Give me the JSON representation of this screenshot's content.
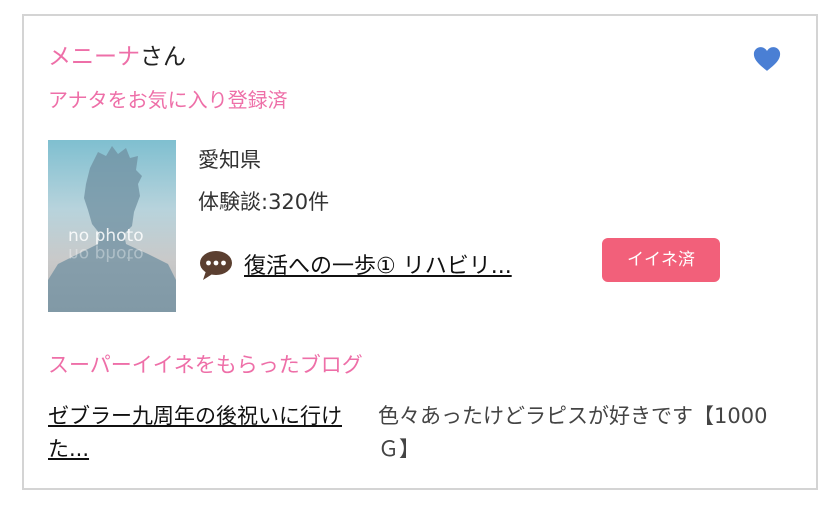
{
  "user": {
    "name": "メニーナ",
    "honorific": "さん",
    "favorite_status": "アナタをお気に入り登録済",
    "photo_placeholder": "no photo",
    "prefecture": "愛知県",
    "experience_count": "体験談:320件"
  },
  "latest_post": {
    "title": "復活への一歩① リハビリ...",
    "like_label": "イイネ済"
  },
  "super_like": {
    "section_title": "スーパーイイネをもらったブログ",
    "blog_title": "ゼブラー九周年の後祝いに行けた...",
    "comment": "色々あったけどラピスが好きです【1000Ｇ】"
  },
  "colors": {
    "accent_pink": "#ee6fa8",
    "heart_blue": "#4a7fd4",
    "badge_red": "#f2607a"
  },
  "icons": [
    "heart-icon",
    "chat-bubble-icon"
  ]
}
